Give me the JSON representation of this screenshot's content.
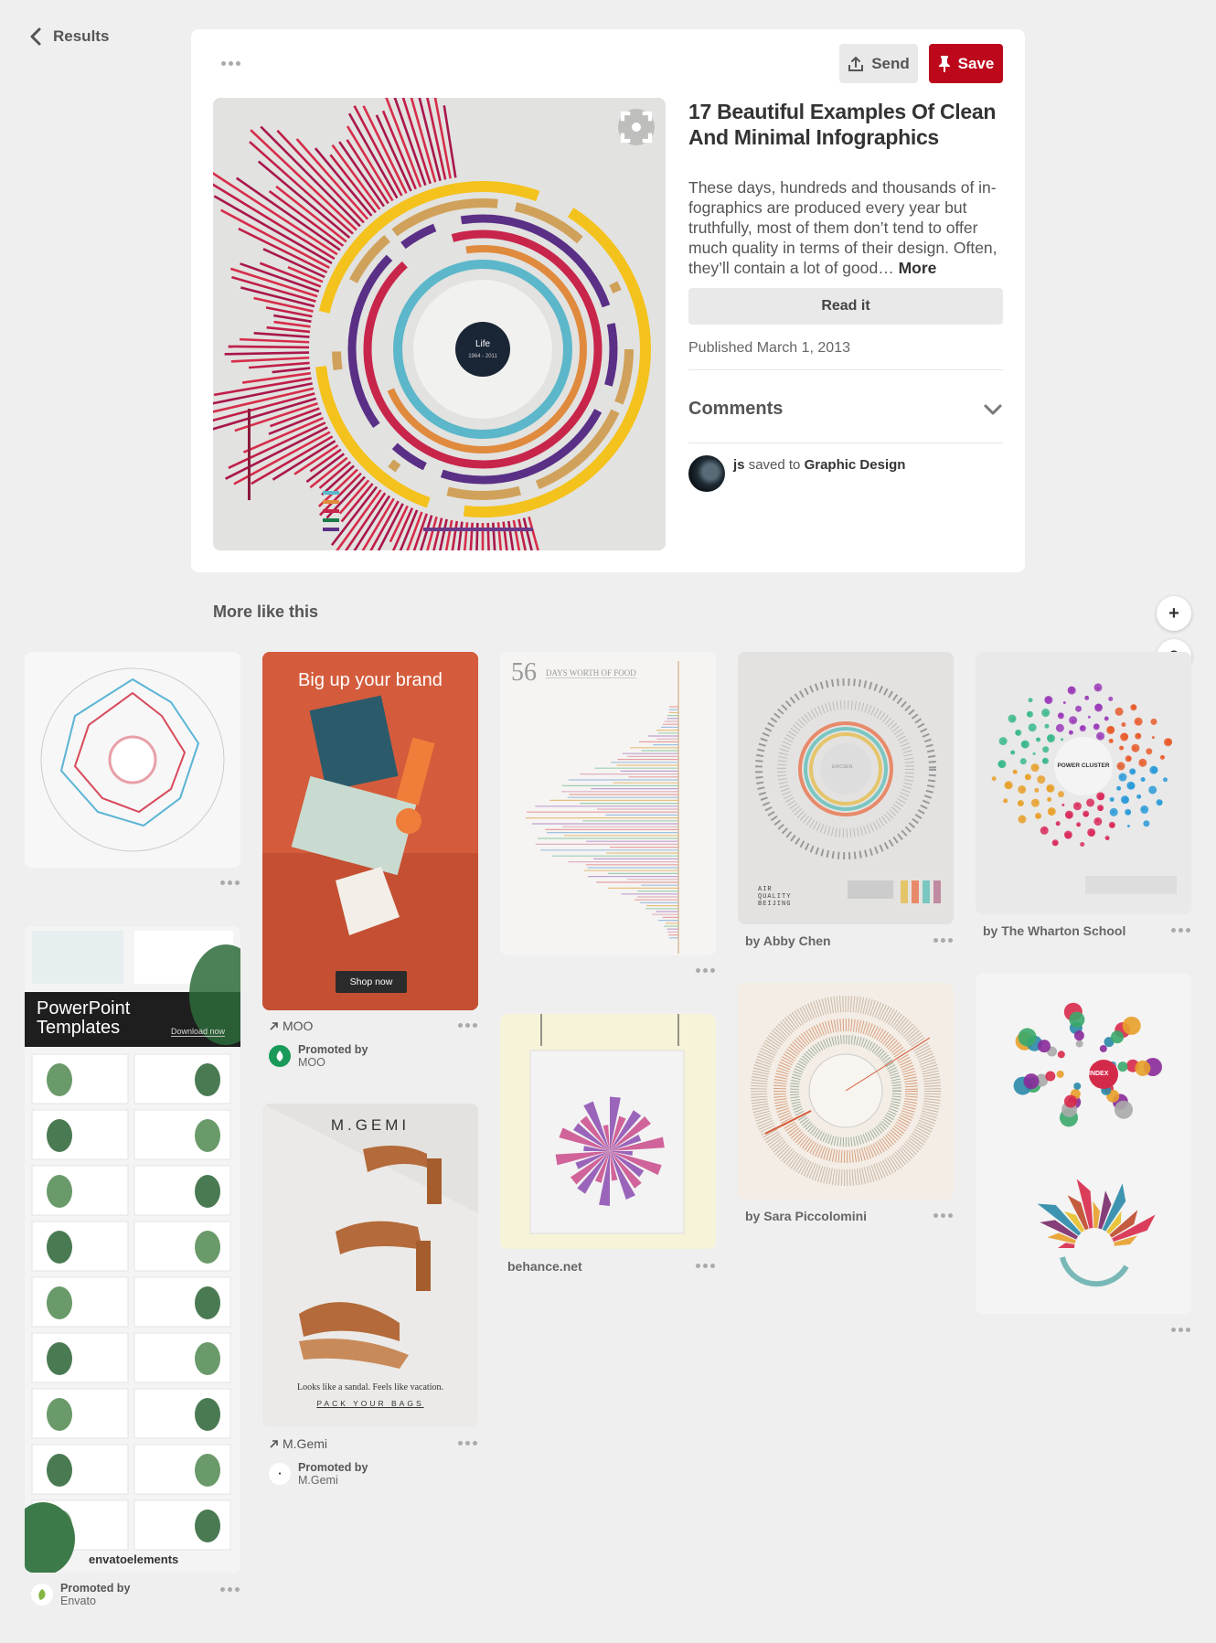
{
  "nav": {
    "back_label": "Results"
  },
  "actions": {
    "send_label": "Send",
    "save_label": "Save"
  },
  "pin": {
    "title": "17 Beautiful Examples Of Clean And Minimal Infographics",
    "description": "These days, hundreds and thousands of in-fographics are produced every year but truthfully, most of them don’t tend to offer much quality in terms of their design. Often, they’ll contain a lot of good…",
    "more_label": "More",
    "read_label": "Read it",
    "published": "Published March 1, 2013",
    "comments_label": "Comments",
    "saver_name": "js",
    "saver_mid": "saved to",
    "board": "Graphic Design",
    "image_center_title": "Life",
    "image_center_sub": "1964 - 2011"
  },
  "more_like_this": {
    "heading": "More like this",
    "add_icon_label": "+",
    "help_icon_label": "?",
    "pins": {
      "moo": {
        "headline": "Big up your brand",
        "cta": "Shop now",
        "link": "MOO",
        "promoted_by": "Promoted by",
        "advertiser": "MOO"
      },
      "mgemi": {
        "brand": "M.GEMI",
        "tagline": "Looks like a sandal. Feels like vacation.",
        "cta": "PACK YOUR BAGS",
        "link": "M.Gemi",
        "promoted_by": "Promoted by",
        "advertiser": "M.Gemi"
      },
      "envato": {
        "banner_line1": "PowerPoint",
        "banner_line2": "Templates",
        "banner_cta": "Download now",
        "brand": "envatoelements",
        "promoted_by": "Promoted by",
        "advertiser": "Envato"
      },
      "food": {
        "number": "56",
        "title": "DAYS WORTH OF FOOD"
      },
      "behance": {
        "source": "behance.net"
      },
      "air": {
        "line1": "AIR",
        "line2": "QUALITY",
        "line3": "BEIJING",
        "center": "ERICSEN"
      },
      "abby": {
        "credit": "by Abby Chen"
      },
      "sara": {
        "credit": "by Sara Piccolomini"
      },
      "wharton": {
        "credit": "by The Wharton School",
        "center": "POWER CLUSTER"
      },
      "index": {
        "center": "INDEX"
      }
    }
  },
  "colors": {
    "save_red": "#bd081c",
    "page_bg": "#efefef"
  }
}
